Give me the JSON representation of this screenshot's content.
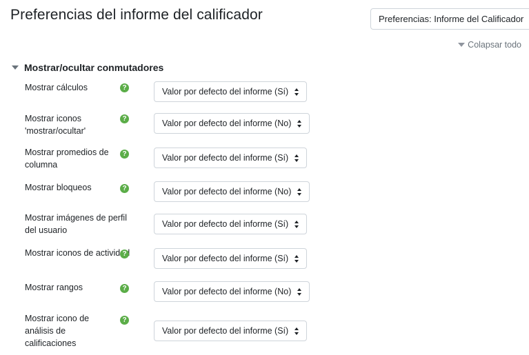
{
  "page": {
    "title": "Preferencias del informe del calificador",
    "jump_select_value": "Preferencias: Informe del Calificador",
    "collapse_all": "Colapsar todo"
  },
  "section": {
    "title": "Mostrar/ocultar conmutadores"
  },
  "settings": [
    {
      "label": "Mostrar cálculos",
      "has_help": true,
      "value": "Valor por defecto del informe (Sí)"
    },
    {
      "label": "Mostrar iconos 'mostrar/ocultar'",
      "has_help": true,
      "value": "Valor por defecto del informe (No)"
    },
    {
      "label": "Mostrar promedios de columna",
      "has_help": true,
      "value": "Valor por defecto del informe (Sí)"
    },
    {
      "label": "Mostrar bloqueos",
      "has_help": true,
      "value": "Valor por defecto del informe (No)"
    },
    {
      "label": "Mostrar imágenes de perfil del usuario",
      "has_help": false,
      "value": "Valor por defecto del informe (Sí)"
    },
    {
      "label": "Mostrar iconos de actividad",
      "has_help": true,
      "value": "Valor por defecto del informe (Sí)"
    },
    {
      "label": "Mostrar rangos",
      "has_help": true,
      "value": "Valor por defecto del informe (No)"
    },
    {
      "label": "Mostrar icono de análisis de calificaciones",
      "has_help": true,
      "value": "Valor por defecto del informe (Sí)"
    }
  ],
  "colors": {
    "help_icon": "#5bad48",
    "muted_text": "#6a737b",
    "border": "#ced4da"
  },
  "icons": {
    "help": "question-circle-icon",
    "caret": "caret-down-icon",
    "select_arrows": "sort-icon"
  }
}
